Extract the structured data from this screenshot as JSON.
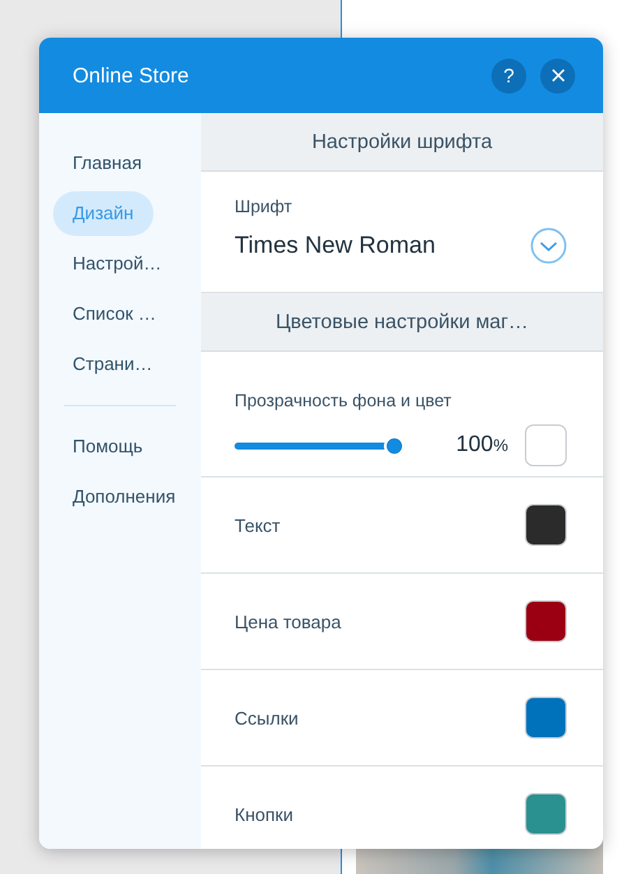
{
  "window": {
    "title": "Online Store",
    "help_label": "?"
  },
  "sidebar": {
    "items": [
      {
        "label": "Главная",
        "selected": false
      },
      {
        "label": "Дизайн",
        "selected": true
      },
      {
        "label": "Настрой…",
        "selected": false
      },
      {
        "label": "Список …",
        "selected": false
      },
      {
        "label": "Страни…",
        "selected": false
      }
    ],
    "secondary_items": [
      {
        "label": "Помощь",
        "selected": false
      },
      {
        "label": "Дополнения",
        "selected": false
      }
    ]
  },
  "sections": [
    {
      "title": "Настройки шрифта",
      "rows": [
        {
          "kind": "font",
          "label": "Шрифт",
          "value": "Times New Roman"
        }
      ]
    },
    {
      "title": "Цветовые настройки маг…",
      "rows": [
        {
          "kind": "opacity",
          "label": "Прозрачность фона и цвет",
          "level": 1,
          "reading": "100",
          "unit": "%",
          "color": "#ffffff"
        },
        {
          "kind": "color",
          "label": "Текст",
          "color": "#2b2b2b"
        },
        {
          "kind": "color",
          "label": "Цена товара",
          "color": "#9b0012"
        },
        {
          "kind": "color",
          "label": "Ссылки",
          "color": "#0072bc"
        },
        {
          "kind": "color",
          "label": "Кнопки",
          "color": "#2a9090"
        }
      ]
    }
  ]
}
